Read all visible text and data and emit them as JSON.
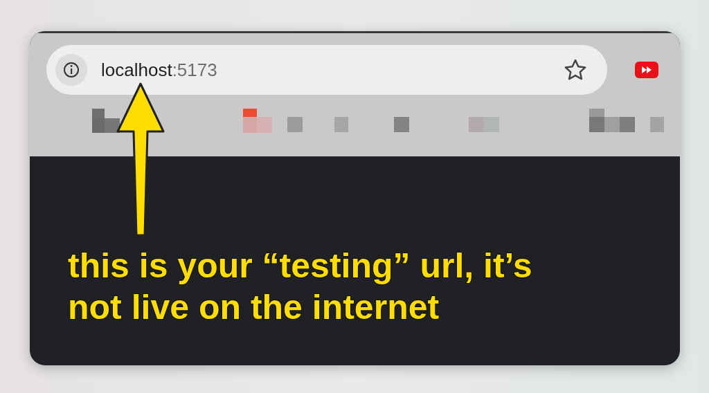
{
  "address_bar": {
    "host": "localhost",
    "port": ":5173"
  },
  "annotation": {
    "lines": [
      "this is your “testing” url, it’s",
      "not live on the internet"
    ]
  }
}
